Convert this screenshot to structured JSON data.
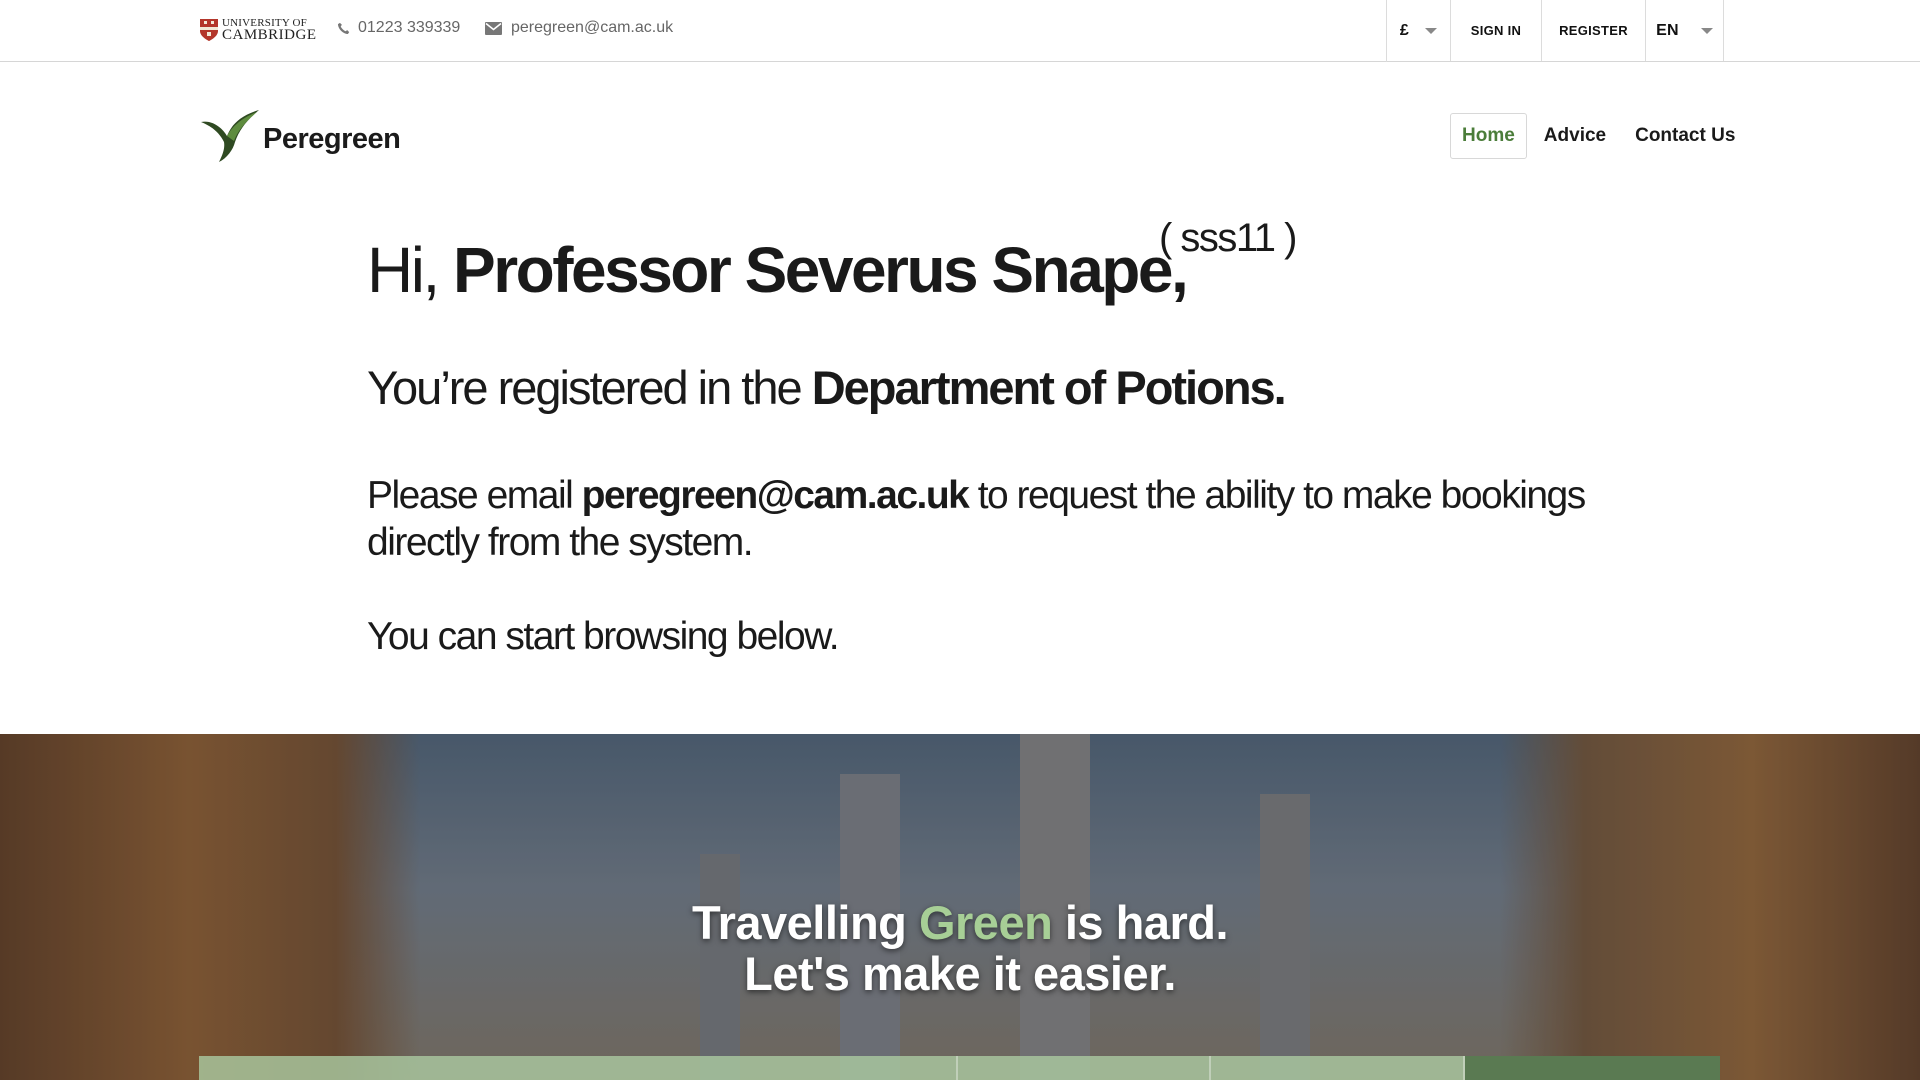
{
  "topbar": {
    "university_line1": "UNIVERSITY OF",
    "university_line2": "CAMBRIDGE",
    "phone": "01223 339339",
    "email": "peregreen@cam.ac.uk",
    "currency": "£",
    "sign_in": "SIGN IN",
    "register": "REGISTER",
    "language": "EN",
    "icons": {
      "phone": "phone-icon",
      "email": "envelope-icon",
      "crest": "cambridge-crest-icon"
    }
  },
  "header": {
    "brand_name": "Peregreen",
    "logo_icon": "bird-logo-icon",
    "nav": [
      {
        "label": "Home",
        "active": true
      },
      {
        "label": "Advice",
        "active": false
      },
      {
        "label": "Contact Us",
        "active": false
      }
    ],
    "accent_color": "#4b7d3a"
  },
  "greeting": {
    "hi": "Hi, ",
    "name": "Professor Severus Snape,",
    "crsid": "( sss11 )"
  },
  "department": {
    "prefix": "You’re registered in the ",
    "name": "Department of Potions."
  },
  "note": {
    "prefix": "Please email ",
    "email": "peregreen@cam.ac.uk",
    "suffix": " to request the ability to make bookings directly from the system."
  },
  "browse_text": "You can start browsing below.",
  "hero": {
    "line1_prefix": "Travelling ",
    "line1_green": "Green",
    "line1_suffix": " is hard.",
    "line2": "Let's make it easier.",
    "green_color": "#a7cf96"
  }
}
